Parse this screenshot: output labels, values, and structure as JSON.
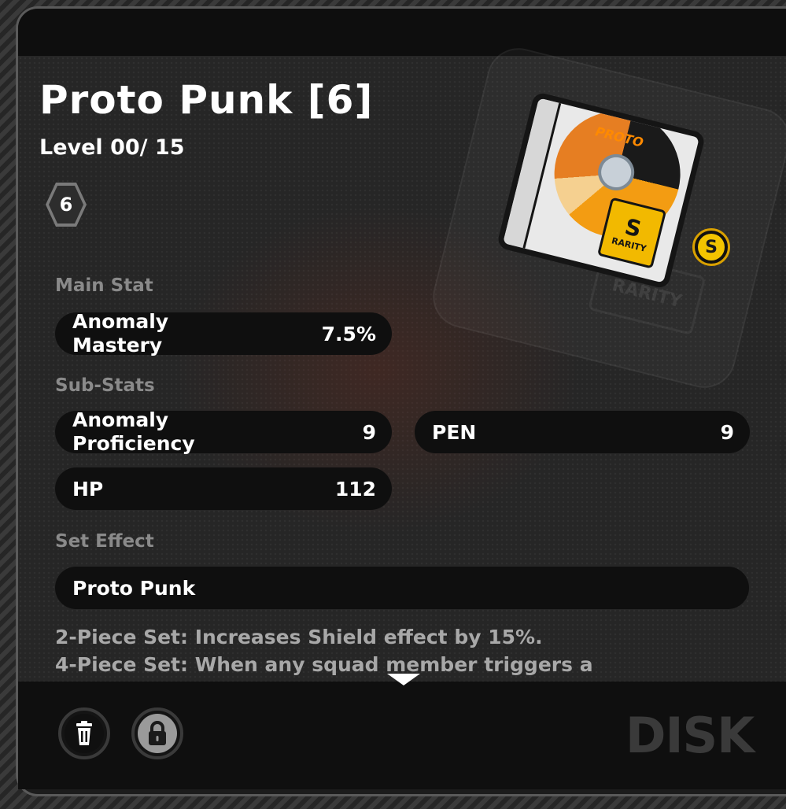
{
  "disc": {
    "title": "Proto Punk [6]",
    "level": "Level 00/ 15",
    "slot": "6",
    "art_logo": "PROTO",
    "art_rarity_letter": "S",
    "art_rarity_word": "RARITY",
    "background_rarity_word": "RARITY",
    "rank": "S"
  },
  "main_stat": {
    "label": "Main Stat",
    "name_line1": "Anomaly",
    "name_line2": "Mastery",
    "value": "7.5%"
  },
  "sub_stats": {
    "label": "Sub-Stats",
    "items": [
      {
        "name_line1": "Anomaly",
        "name_line2": "Proficiency",
        "value": "9"
      },
      {
        "name": "PEN",
        "value": "9"
      },
      {
        "name": "HP",
        "value": "112"
      }
    ]
  },
  "set_effect": {
    "label": "Set Effect",
    "name": "Proto Punk",
    "line1": "2-Piece Set: Increases Shield effect by 15%.",
    "line2": "4-Piece Set: When any squad member triggers a"
  },
  "footer": {
    "trash_icon": "trash-icon",
    "lock_icon": "lock-icon",
    "watermark": "DISK"
  },
  "colors": {
    "rank_gold": "#f3c400",
    "pill_bg": "#0f0f0f",
    "label_gray": "#8a8a8a"
  }
}
